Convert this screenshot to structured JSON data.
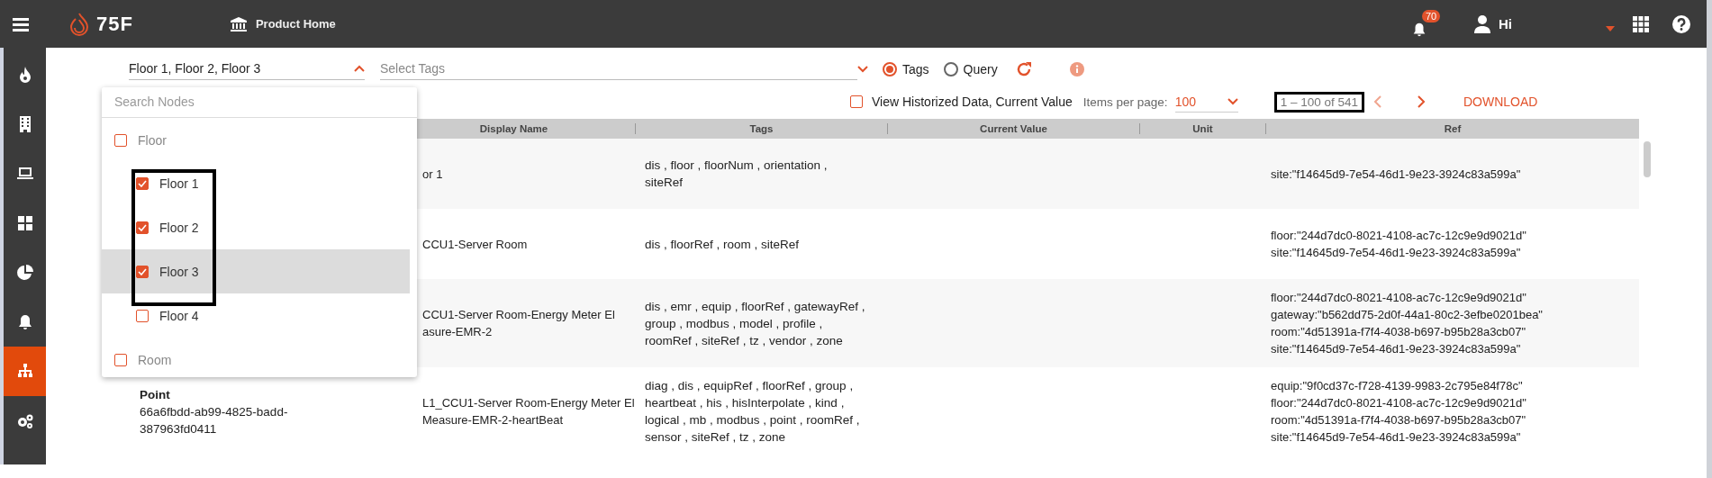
{
  "top_bar": {
    "brand": "75F",
    "page_title": "Product Home",
    "notification_count": "70",
    "greeting": "Hi"
  },
  "sidebar": {
    "items": [
      {
        "kind": "flame",
        "selected": false
      },
      {
        "kind": "building",
        "selected": false
      },
      {
        "kind": "laptop",
        "selected": false
      },
      {
        "kind": "grid",
        "selected": false
      },
      {
        "kind": "pie",
        "selected": false
      },
      {
        "kind": "bell",
        "selected": false
      },
      {
        "kind": "hierarchy",
        "selected": true
      },
      {
        "kind": "gears",
        "selected": false
      }
    ]
  },
  "filters": {
    "node_select": {
      "value": "Floor 1, Floor 2, Floor 3",
      "expanded": true
    },
    "tags_select": {
      "placeholder": "Select Tags"
    },
    "mode_options": [
      {
        "label": "Tags",
        "selected": true
      },
      {
        "label": "Query",
        "selected": false
      }
    ]
  },
  "options": {
    "historized": {
      "label": "View Historized Data, Current Value",
      "checked": false
    },
    "items_per_page_label": "Items per page:",
    "items_per_page": "100",
    "range": "1 – 100 of 541",
    "download": "DOWNLOAD"
  },
  "table": {
    "columns": [
      "Display Name",
      "Tags",
      "Current Value",
      "Unit",
      "Ref"
    ],
    "rows": [
      {
        "display_name": [
          "or 1"
        ],
        "tags": "dis , floor , floorNum , orientation , siteRef",
        "ref": [
          "site:\"f14645d9-7e54-46d1-9e23-3924c83a599a\""
        ]
      },
      {
        "display_name": [
          "CCU1-Server Room"
        ],
        "tags": "dis , floorRef , room , siteRef",
        "ref": [
          "floor:\"244d7dc0-8021-4108-ac7c-12c9e9d9021d\"",
          "site:\"f14645d9-7e54-46d1-9e23-3924c83a599a\""
        ]
      },
      {
        "display_name": [
          "CCU1-Server Room-Energy Meter El",
          "asure-EMR-2"
        ],
        "tags": "dis , emr , equip , floorRef , gatewayRef , group , modbus , model , profile , roomRef , siteRef , tz , vendor , zone",
        "ref": [
          "floor:\"244d7dc0-8021-4108-ac7c-12c9e9d9021d\"",
          "gateway:\"b562dd75-2d0f-44a1-80c2-3efbe0201bea\"",
          "room:\"4d51391a-f7f4-4038-b697-b95b28a3cb07\"",
          "site:\"f14645d9-7e54-46d1-9e23-3924c83a599a\""
        ]
      },
      {
        "type": "Point",
        "id": "66a6fbdd-ab99-4825-badd-387963fd0411",
        "display_name": [
          "L1_CCU1-Server Room-Energy Meter El",
          "Measure-EMR-2-heartBeat"
        ],
        "tags": "diag , dis , equipRef , floorRef , group , heartbeat , his , hisInterpolate , kind , logical , mb , modbus , point , roomRef , sensor , siteRef , tz , zone",
        "ref": [
          "equip:\"9f0cd37c-f728-4139-9983-2c795e84f78c\"",
          "floor:\"244d7dc0-8021-4108-ac7c-12c9e9d9021d\"",
          "room:\"4d51391a-f7f4-4038-b697-b95b28a3cb07\"",
          "site:\"f14645d9-7e54-46d1-9e23-3924c83a599a\""
        ]
      }
    ]
  },
  "node_dropdown": {
    "search_placeholder": "Search Nodes",
    "items": [
      {
        "label": "Floor",
        "checked": false,
        "children": [
          {
            "label": "Floor 1",
            "checked": true,
            "highlighted": false
          },
          {
            "label": "Floor 2",
            "checked": true,
            "highlighted": false
          },
          {
            "label": "Floor 3",
            "checked": true,
            "highlighted": true
          },
          {
            "label": "Floor 4",
            "checked": false,
            "highlighted": false
          }
        ]
      },
      {
        "label": "Room",
        "checked": false
      }
    ]
  }
}
